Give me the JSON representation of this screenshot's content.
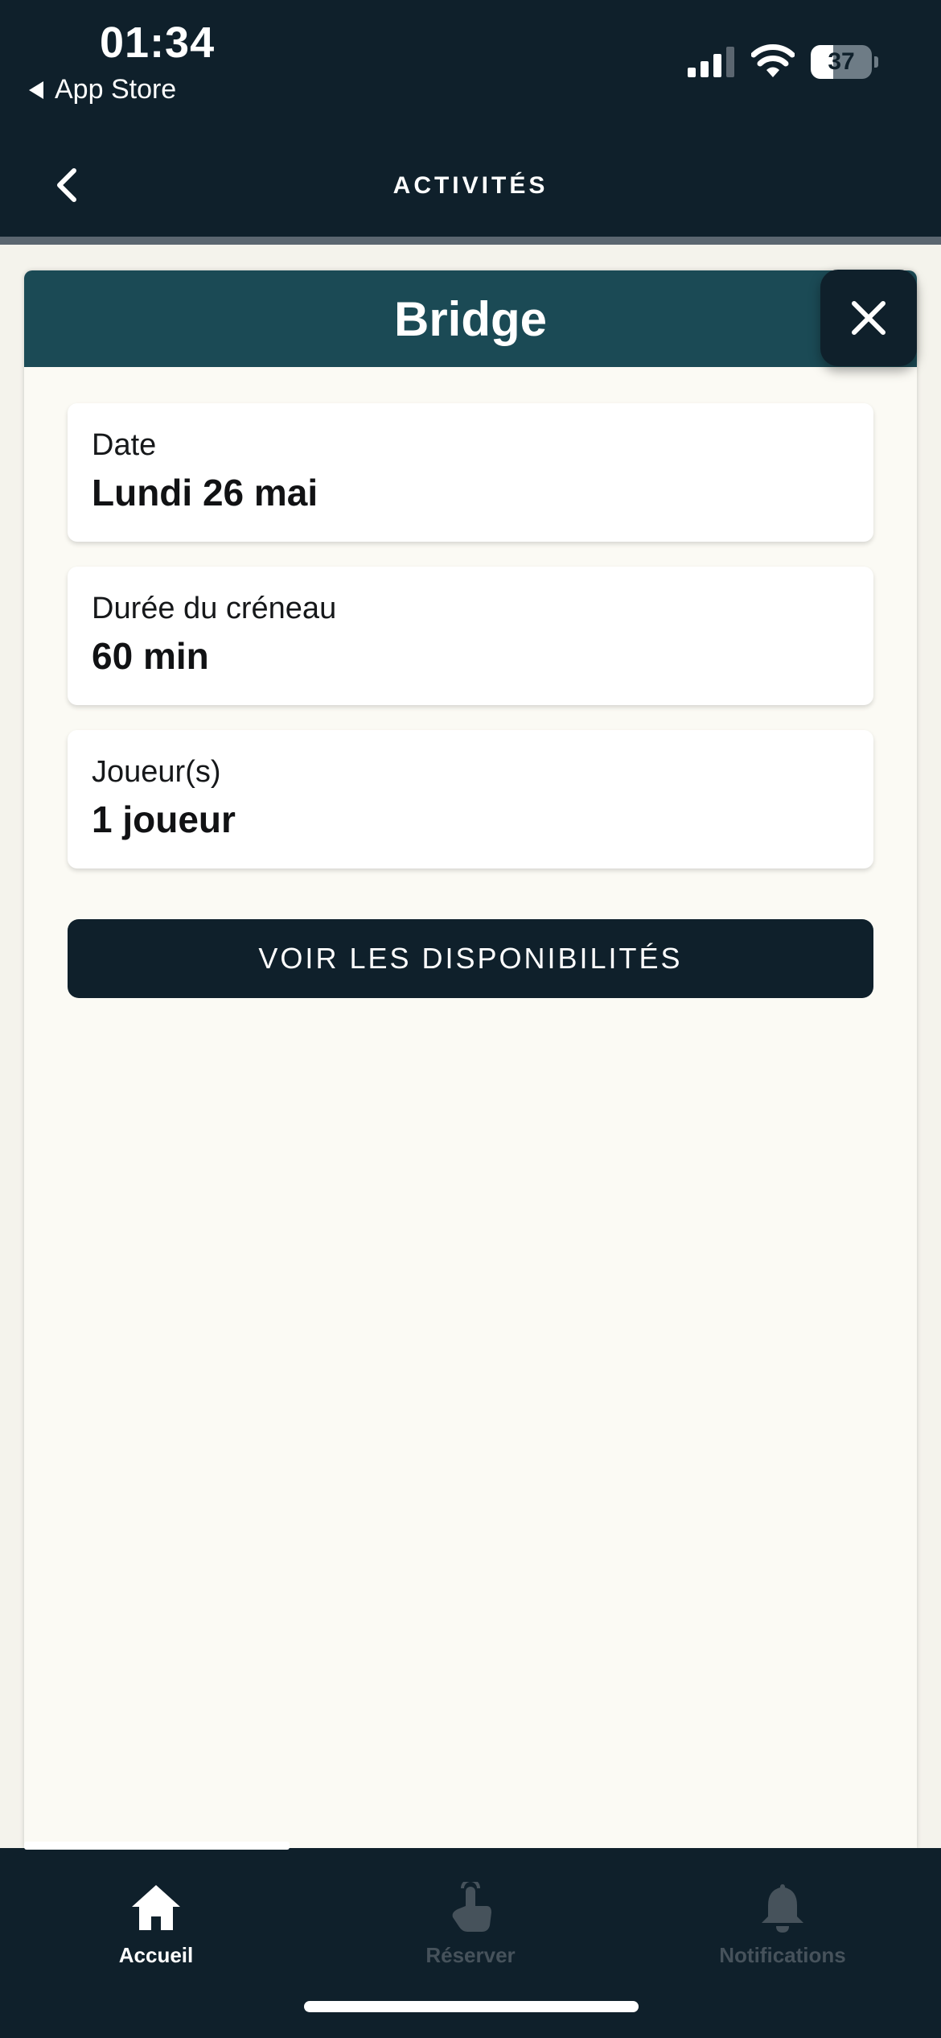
{
  "status_bar": {
    "time": "01:34",
    "back_app": "App Store",
    "battery_level": "37",
    "battery_fraction": 0.37
  },
  "header": {
    "title": "ACTIVITÉS",
    "back_icon": "chevron-left-icon"
  },
  "sheet": {
    "title": "Bridge",
    "close_icon": "close-icon",
    "fields": [
      {
        "label": "Date",
        "value": "Lundi 26 mai"
      },
      {
        "label": "Durée du créneau",
        "value": "60 min"
      },
      {
        "label": "Joueur(s)",
        "value": "1 joueur"
      }
    ],
    "cta_label": "VOIR LES DISPONIBILITÉS"
  },
  "tab_bar": {
    "tabs": [
      {
        "label": "Accueil",
        "icon": "home-icon",
        "active": true
      },
      {
        "label": "Réserver",
        "icon": "tap-hand-icon",
        "active": false
      },
      {
        "label": "Notifications",
        "icon": "bell-icon",
        "active": false
      }
    ]
  },
  "colors": {
    "background_dark": "#0f202b",
    "sheet_header": "#1b4a55",
    "sheet_background": "#fbfaf4",
    "inactive_tab": "#46525b"
  }
}
